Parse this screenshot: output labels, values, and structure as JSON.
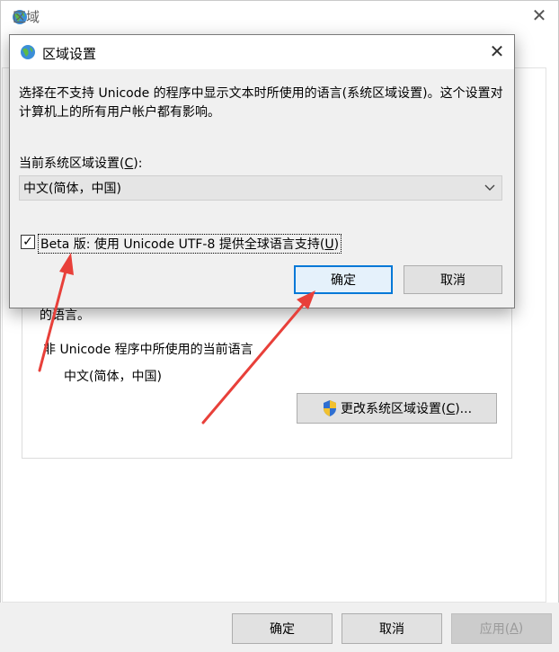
{
  "outer_window": {
    "title": "区域",
    "close_glyph": "✕",
    "partial_text": "的语言。",
    "nonunicode_label": "非 Unicode 程序中所使用的当前语言",
    "nonunicode_value": "中文(简体，中国)",
    "change_button": {
      "prefix": "更改系统区域设置(",
      "hotkey": "C",
      "suffix": ")..."
    },
    "footer": {
      "ok": "确定",
      "cancel": "取消",
      "apply_prefix": "应用(",
      "apply_hotkey": "A",
      "apply_suffix": ")"
    }
  },
  "dialog": {
    "title": "区域设置",
    "close_glyph": "✕",
    "description": "选择在不支持 Unicode 的程序中显示文本时所使用的语言(系统区域设置)。这个设置对计算机上的所有用户帐户都有影响。",
    "current_label_prefix": "当前系统区域设置(",
    "current_label_hotkey": "C",
    "current_label_suffix": "):",
    "current_value": "中文(简体，中国)",
    "beta_checked": true,
    "beta_check_glyph": "✓",
    "beta_label_prefix": "Beta 版: 使用 Unicode UTF-8 提供全球语言支持(",
    "beta_label_hotkey": "U",
    "beta_label_suffix": ")",
    "ok": "确定",
    "cancel": "取消"
  },
  "icons": {
    "globe": "globe-icon",
    "shield": "uac-shield-icon",
    "chevron": "chevron-down-icon"
  },
  "colors": {
    "accent": "#0078d7",
    "arrow": "#e8403a"
  }
}
